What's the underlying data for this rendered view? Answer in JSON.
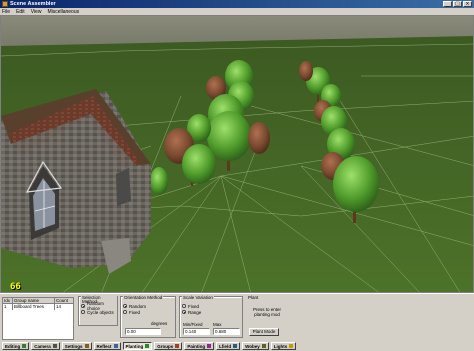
{
  "window": {
    "title": "Scene Assembler",
    "controls": [
      "_",
      "□",
      "×"
    ]
  },
  "menu": [
    "File",
    "Edit",
    "View",
    "Miscellaneous"
  ],
  "viewport": {
    "fps_counter": "66"
  },
  "group_table": {
    "columns": [
      "Idx",
      "Group name",
      "Count"
    ],
    "rows": [
      {
        "idx": "1",
        "name": "Billboard Trees",
        "count": "14"
      }
    ]
  },
  "selection_method": {
    "title": "Selection Method",
    "options": [
      "Random choice",
      "Cycle objects"
    ],
    "selected": "Random choice"
  },
  "orientation_method": {
    "title": "Orientation Method",
    "options": [
      "Random",
      "Fixed"
    ],
    "selected": "Random",
    "degrees_label": "degrees",
    "degrees_value": "0.00"
  },
  "scale_variation": {
    "title": "Scale Variation",
    "options": [
      "Fixed",
      "Range"
    ],
    "selected": "Range",
    "min_label": "Min/Fixed",
    "max_label": "Max",
    "min_value": "0.140",
    "max_value": "0.680"
  },
  "plant": {
    "title": "Plant",
    "instructions": "Press to enter planting mod",
    "button_label": "Plant Mode"
  },
  "tabs": [
    {
      "label": "Editing",
      "icon": "pencil-icon",
      "color": "#3a7a3a"
    },
    {
      "label": "Camera",
      "icon": "camera-icon",
      "color": "#505050"
    },
    {
      "label": "Settings",
      "icon": "gear-icon",
      "color": "#806020"
    },
    {
      "label": "Reflect",
      "icon": "mirror-icon",
      "color": "#4060a0"
    },
    {
      "label": "Planting",
      "icon": "tree-icon",
      "color": "#2a8a2a",
      "active": true
    },
    {
      "label": "Groups",
      "icon": "group-icon",
      "color": "#a04020"
    },
    {
      "label": "Painting",
      "icon": "brush-icon",
      "color": "#8a2a8a"
    },
    {
      "label": "Lfield",
      "icon": "field-icon",
      "color": "#206080"
    },
    {
      "label": "Wobey",
      "icon": "wave-icon",
      "color": "#606020"
    },
    {
      "label": "Lights",
      "icon": "bulb-icon",
      "color": "#c0a000"
    }
  ]
}
